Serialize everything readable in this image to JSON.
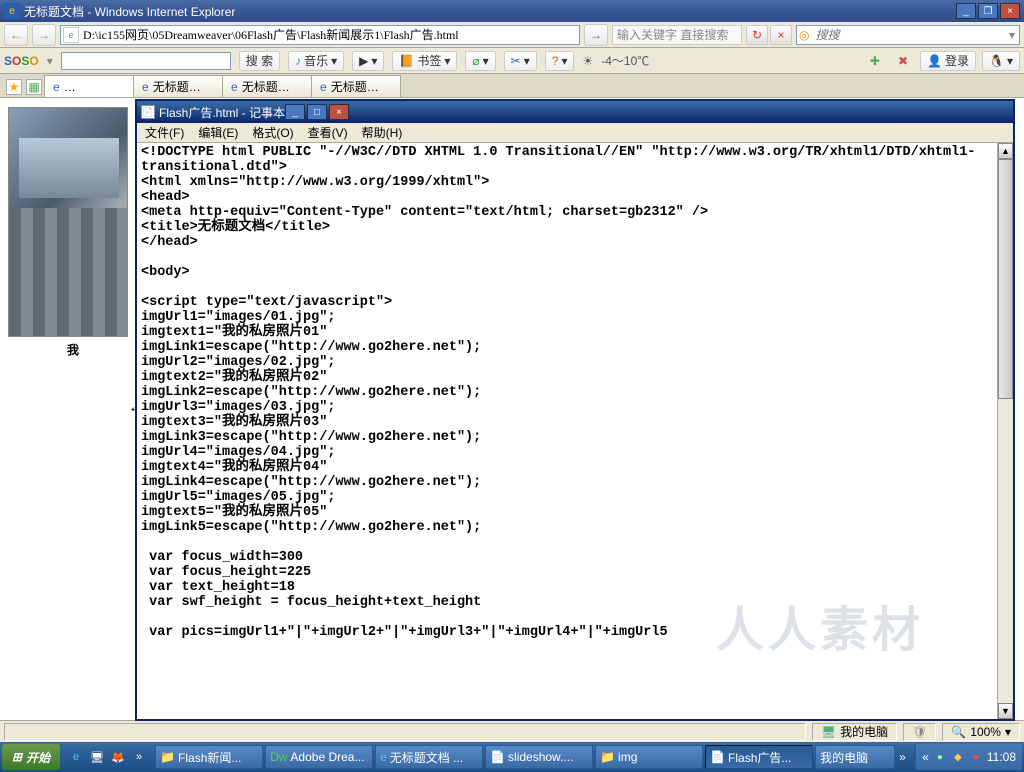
{
  "window": {
    "title": "无标题文档 - Windows Internet Explorer",
    "min": "_",
    "max": "□",
    "restore": "❐",
    "close": "×"
  },
  "addressbar": {
    "back": "←",
    "fwd": "→",
    "url": "D:\\ic155网页\\05Dreamweaver\\06Flash广告\\Flash新闻展示1\\Flash广告.html",
    "hint": "输入关键字 直接搜索",
    "refresh": "↻",
    "stop": "×",
    "search_placeholder": "搜搜"
  },
  "toolbar2": {
    "soso": "SOSO",
    "searchbtn": "搜 索",
    "music": "音乐",
    "player": "♪",
    "bookmark": "书签",
    "weather": "-4～10℃",
    "login": "登录"
  },
  "tabs": {
    "t1": "…",
    "t2": "无标题…",
    "t3": "无标题…",
    "t4": "无标题…"
  },
  "flash": {
    "caption": "我"
  },
  "notepad": {
    "title": "Flash广告.html - 记事本",
    "menu": {
      "file": "文件(F)",
      "edit": "编辑(E)",
      "format": "格式(O)",
      "view": "查看(V)",
      "help": "帮助(H)"
    },
    "content": "<!DOCTYPE html PUBLIC \"-//W3C//DTD XHTML 1.0 Transitional//EN\" \"http://www.w3.org/TR/xhtml1/DTD/xhtml1-\ntransitional.dtd\">\n<html xmlns=\"http://www.w3.org/1999/xhtml\">\n<head>\n<meta http-equiv=\"Content-Type\" content=\"text/html; charset=gb2312\" />\n<title>无标题文档</title>\n</head>\n\n<body>\n\n<script type=\"text/javascript\">\nimgUrl1=\"images/01.jpg\";\nimgtext1=\"我的私房照片01\"\nimgLink1=escape(\"http://www.go2here.net\");\nimgUrl2=\"images/02.jpg\";\nimgtext2=\"我的私房照片02\"\nimgLink2=escape(\"http://www.go2here.net\");\nimgUrl3=\"images/03.jpg\";\nimgtext3=\"我的私房照片03\"\nimgLink3=escape(\"http://www.go2here.net\");\nimgUrl4=\"images/04.jpg\";\nimgtext4=\"我的私房照片04\"\nimgLink4=escape(\"http://www.go2here.net\");\nimgUrl5=\"images/05.jpg\";\nimgtext5=\"我的私房照片05\"\nimgLink5=escape(\"http://www.go2here.net\");\n\n var focus_width=300\n var focus_height=225\n var text_height=18\n var swf_height = focus_height+text_height\n\n var pics=imgUrl1+\"|\"+imgUrl2+\"|\"+imgUrl3+\"|\"+imgUrl4+\"|\"+imgUrl5"
  },
  "statusbar": {
    "mycomputer": "我的电脑",
    "zoom": "100%"
  },
  "taskbar": {
    "start": "开始",
    "items": {
      "b1": "Flash新闻...",
      "b2": "Adobe Drea...",
      "b3": "无标题文档 ...",
      "b4": "slideshow....",
      "b5": "img",
      "b6": "Flash广告...",
      "b7": "我的电脑"
    },
    "more": "»",
    "tray_expand": "«",
    "clock": "11:08"
  },
  "watermark": "人人素材"
}
